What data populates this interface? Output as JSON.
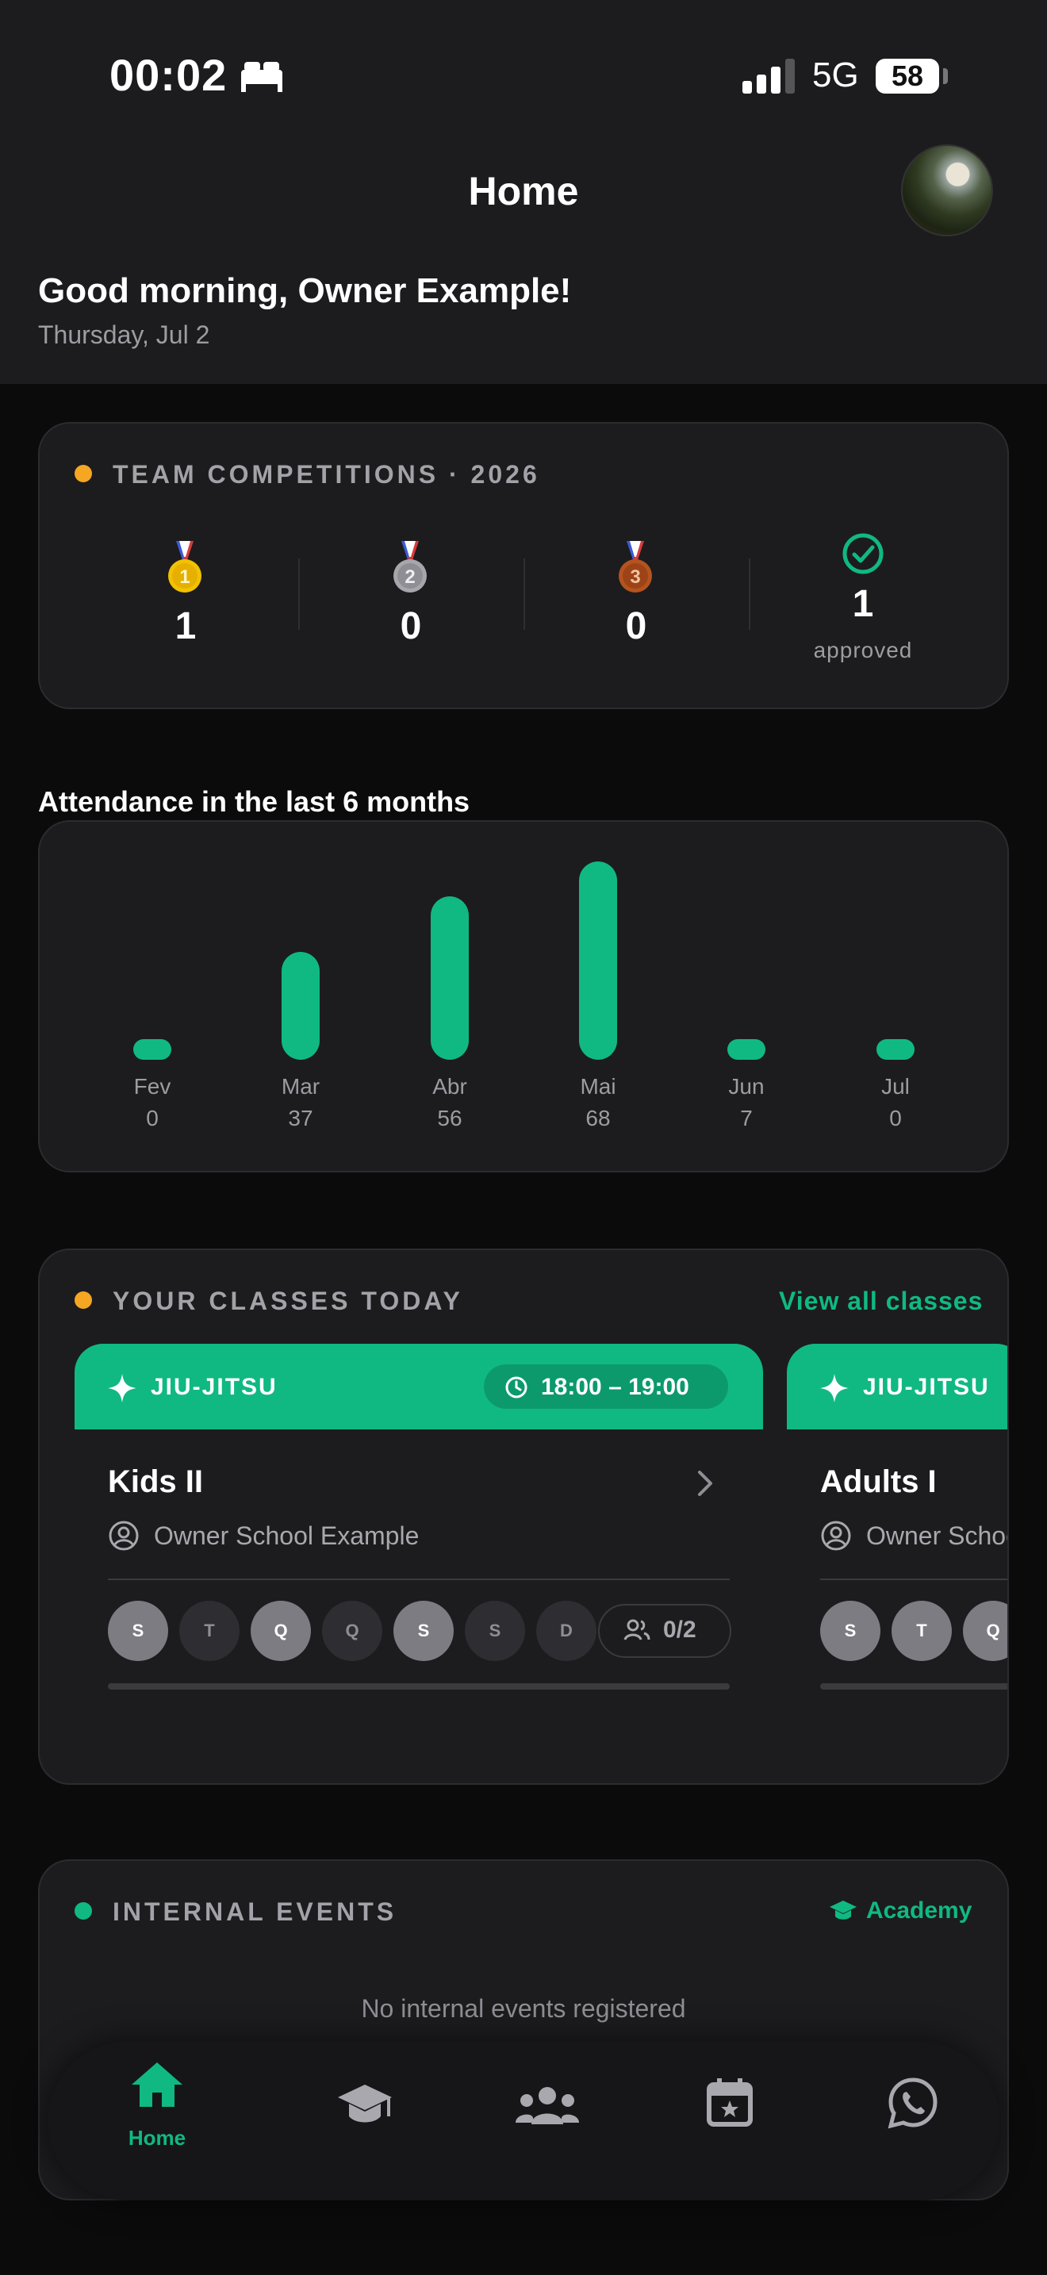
{
  "status_bar": {
    "time": "00:02",
    "network": "5G",
    "battery": "58"
  },
  "header": {
    "title": "Home",
    "greeting": "Good morning, Owner Example!",
    "date": "Thursday, Jul 2"
  },
  "competitions": {
    "title": "TEAM COMPETITIONS · 2026",
    "gold": "1",
    "silver": "0",
    "bronze": "0",
    "approved": "1",
    "approved_label": "approved",
    "medal_digits": [
      "1",
      "2",
      "3"
    ],
    "accent": "#f5a623"
  },
  "attendance": {
    "title": "Attendance in the last 6 months",
    "months": [
      "Fev",
      "Mar",
      "Abr",
      "Mai",
      "Jun",
      "Jul"
    ],
    "counts": [
      "0",
      "37",
      "56",
      "68",
      "7",
      "0"
    ]
  },
  "chart_data": {
    "type": "bar",
    "title": "Attendance in the last 6 months",
    "categories": [
      "Fev",
      "Mar",
      "Abr",
      "Mai",
      "Jun",
      "Jul"
    ],
    "values": [
      0,
      37,
      56,
      68,
      7,
      0
    ],
    "ylim": [
      0,
      68
    ],
    "grid": false,
    "color": "#10b981"
  },
  "classes": {
    "title": "YOUR CLASSES TODAY",
    "view_all": "View all classes",
    "cards": [
      {
        "type": "JIU-JITSU",
        "time": "18:00 – 19:00",
        "name": "Kids II",
        "school": "Owner School Example",
        "days": [
          "S",
          "T",
          "Q",
          "Q",
          "S",
          "S",
          "D"
        ],
        "days_active": [
          true,
          false,
          true,
          false,
          true,
          false,
          false
        ],
        "seats": "0/2"
      },
      {
        "type": "JIU-JITSU",
        "time": "",
        "name": "Adults I",
        "school": "Owner School Example",
        "days": [
          "S",
          "T",
          "Q"
        ],
        "days_active": [
          true,
          true,
          true
        ],
        "seats": ""
      }
    ]
  },
  "events": {
    "title": "INTERNAL EVENTS",
    "academy": "Academy",
    "empty": "No internal events registered",
    "accent": "#10b981"
  },
  "tabbar": {
    "home_label": "Home",
    "active_color": "#10b981"
  }
}
